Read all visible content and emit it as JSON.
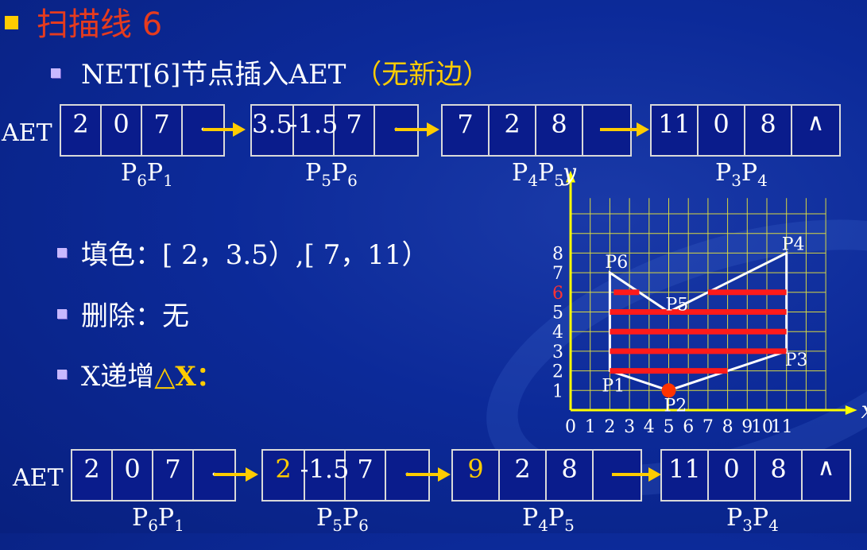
{
  "title": "扫描线 6",
  "subtitle": {
    "main": "NET[6]节点插入AET",
    "note": "（无新边）"
  },
  "items": [
    {
      "text": "填色：[ 2，3.5）,[ 7，11）"
    },
    {
      "text": "删除：无"
    },
    {
      "prefix": "X递增",
      "highlight": "△X："
    }
  ],
  "aet_label": "AET",
  "aet_before": [
    {
      "cells": [
        "2",
        "0",
        "7",
        "."
      ],
      "label_main": "P",
      "sub1": "6",
      "mid": "P",
      "sub2": "1"
    },
    {
      "cells": [
        "3.5",
        "-1.5",
        "7",
        "."
      ],
      "label_main": "P",
      "sub1": "5",
      "mid": "P",
      "sub2": "6"
    },
    {
      "cells": [
        "7",
        "2",
        "8",
        ""
      ],
      "label_main": "P",
      "sub1": "4",
      "mid": "P",
      "sub2": "5"
    },
    {
      "cells": [
        "11",
        "0",
        "8",
        "∧"
      ],
      "label_main": "P",
      "sub1": "3",
      "mid": "P",
      "sub2": "4"
    }
  ],
  "aet_after": [
    {
      "cells": [
        "2",
        "0",
        "7",
        "."
      ],
      "label_main": "P",
      "sub1": "6",
      "mid": "P",
      "sub2": "1"
    },
    {
      "cells": [
        "2",
        "-1.5",
        "7",
        "."
      ],
      "label_main": "P",
      "sub1": "5",
      "mid": "P",
      "sub2": "6"
    },
    {
      "cells": [
        "9",
        "2",
        "8",
        ""
      ],
      "label_main": "P",
      "sub1": "4",
      "mid": "P",
      "sub2": "5"
    },
    {
      "cells": [
        "11",
        "0",
        "8",
        "∧"
      ],
      "label_main": "P",
      "sub1": "3",
      "mid": "P",
      "sub2": "4"
    }
  ],
  "highlighted_after_cells": [
    [
      1,
      0
    ],
    [
      2,
      0
    ]
  ],
  "diagram": {
    "x_label": "x",
    "y_label": "y",
    "x_ticks": [
      "0",
      "1",
      "2",
      "3",
      "4",
      "5",
      "6",
      "7",
      "8",
      "9",
      "10",
      "11"
    ],
    "y_ticks": [
      "1",
      "2",
      "3",
      "4",
      "5",
      "6",
      "7",
      "8"
    ],
    "current_scanline": "6",
    "polygon": [
      {
        "name": "P1",
        "x": 2,
        "y": 2
      },
      {
        "name": "P2",
        "x": 5,
        "y": 1
      },
      {
        "name": "P3",
        "x": 11,
        "y": 3
      },
      {
        "name": "P4",
        "x": 11,
        "y": 8
      },
      {
        "name": "P5",
        "x": 5,
        "y": 5
      },
      {
        "name": "P6",
        "x": 2,
        "y": 7
      }
    ],
    "spans": [
      {
        "y": 2,
        "x1": 2,
        "x2": 8
      },
      {
        "y": 3,
        "x1": 2,
        "x2": 11
      },
      {
        "y": 4,
        "x1": 2,
        "x2": 11
      },
      {
        "y": 5,
        "x1": 2,
        "x2": 11
      },
      {
        "y": 6,
        "x1": 2.2,
        "x2": 3.5
      },
      {
        "y": 6,
        "x1": 7,
        "x2": 11
      }
    ],
    "colors": {
      "span": "#ff1a1a",
      "grid": "#d8d840",
      "axis": "#ffff00",
      "marker": "#ff3300",
      "scanline_label": "#ff3333"
    }
  }
}
